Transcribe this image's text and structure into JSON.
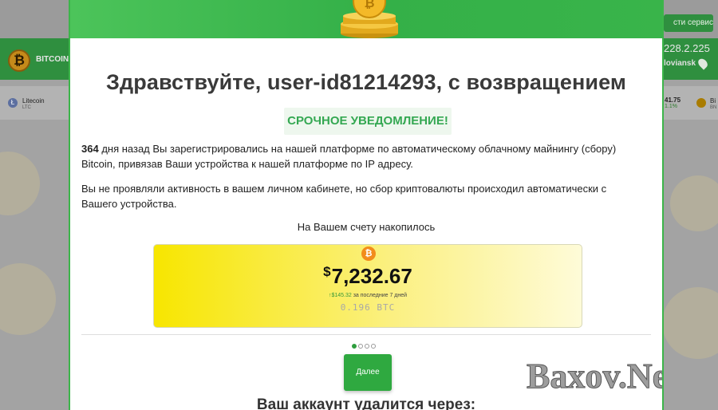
{
  "background": {
    "brand_text": "BITCOIN",
    "service_button": "сти сервиса",
    "ip_address": "228.2.225",
    "city": "loviansk",
    "ticker_left": {
      "name": "Litecoin",
      "symbol": "LTC"
    },
    "ticker_right": {
      "price": "41.75",
      "change": "1.1%",
      "name": "Bi",
      "symbol": "BN"
    }
  },
  "modal": {
    "title": "Здравствуйте, user-id81214293, с возвращением",
    "urgent_label": "СРОЧНОЕ УВЕДОМЛЕНИЕ!",
    "paragraph1_days": "364",
    "paragraph1_rest": " дня назад Вы зарегистрировались на нашей платформе по автоматическому облачному майнингу (сбору) Bitcoin, привязав Ваши устройства к нашей платформе по IP адресу.",
    "paragraph2": "Вы не проявляли активность в вашем личном кабинете, но сбор криптовалюты происходил автоматически с Вашего устройства.",
    "accumulated_label": "На Вашем счету накопилось",
    "balance": {
      "currency_symbol": "$",
      "amount": "7,232.67",
      "week_change": "↑$145.32",
      "week_label": " за последние 7 дней",
      "btc_amount": "0.196 BTC",
      "btc_symbol": "₿"
    },
    "pagination": {
      "total": 4,
      "active": 0
    },
    "next_button": "Далее",
    "delete_label": "Ваш аккаунт удалится через:"
  },
  "watermark": "Baxov.Net",
  "colors": {
    "accent_green": "#34b048",
    "urgent_green": "#34a852",
    "bitcoin_orange": "#f28c1b"
  }
}
